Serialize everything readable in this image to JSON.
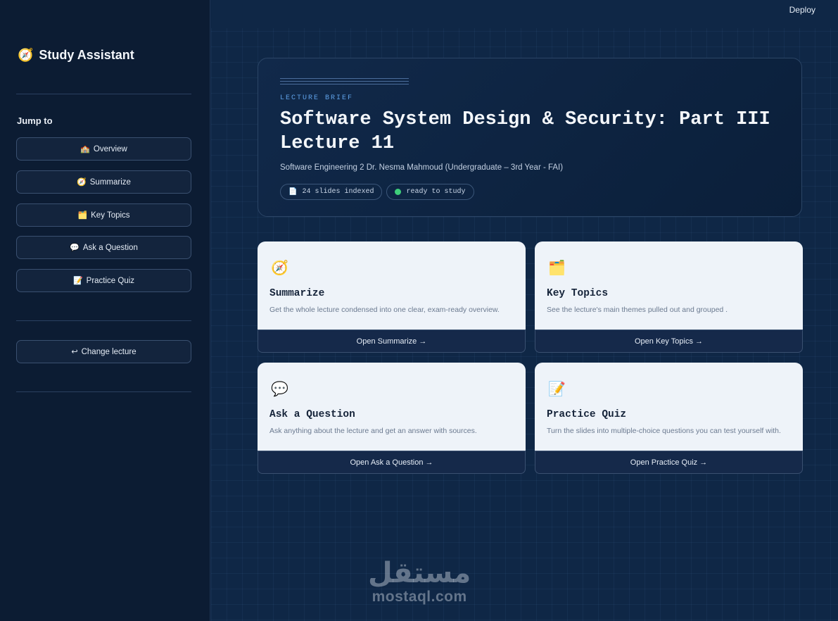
{
  "sidebar": {
    "brand": {
      "icon": "🧭",
      "title": "Study Assistant"
    },
    "jump_label": "Jump to",
    "items": [
      {
        "icon": "🏫",
        "label": "Overview"
      },
      {
        "icon": "🧭",
        "label": "Summarize"
      },
      {
        "icon": "🗂️",
        "label": "Key Topics"
      },
      {
        "icon": "💬",
        "label": "Ask a Question"
      },
      {
        "icon": "📝",
        "label": "Practice Quiz"
      }
    ],
    "change": {
      "icon": "↩",
      "label": "Change lecture"
    }
  },
  "topbar": {
    "deploy": "Deploy"
  },
  "hero": {
    "eyebrow": "LECTURE BRIEF",
    "title": "Software System Design & Security: Part III Lecture 11",
    "subtitle": "Software Engineering 2 Dr. Nesma Mahmoud (Undergraduate – 3rd Year - FAI)",
    "slides_icon": "📄",
    "slides": "24 slides indexed",
    "status": "ready to study",
    "status_color": "#3ecf7a"
  },
  "cards": [
    {
      "icon": "🧭",
      "title": "Summarize",
      "desc": "Get the whole lecture condensed into one clear, exam-ready overview.",
      "button": "Open Summarize →"
    },
    {
      "icon": "🗂️",
      "title": "Key Topics",
      "desc": "See the lecture's main themes pulled out and grouped .",
      "button": "Open Key Topics →"
    },
    {
      "icon": "💬",
      "title": "Ask a Question",
      "desc": "Ask anything about the lecture and get an answer with sources.",
      "button": "Open Ask a Question →"
    },
    {
      "icon": "📝",
      "title": "Practice Quiz",
      "desc": "Turn the slides into multiple-choice questions you can test yourself with.",
      "button": "Open Practice Quiz →"
    }
  ],
  "watermark": {
    "arabic": "مستقل",
    "latin": "mostaql.com"
  },
  "colors": {
    "accent": "#5ea0e6",
    "background": "#0f2746",
    "sidebar": "#0c1c33",
    "card": "#eef3f9"
  }
}
